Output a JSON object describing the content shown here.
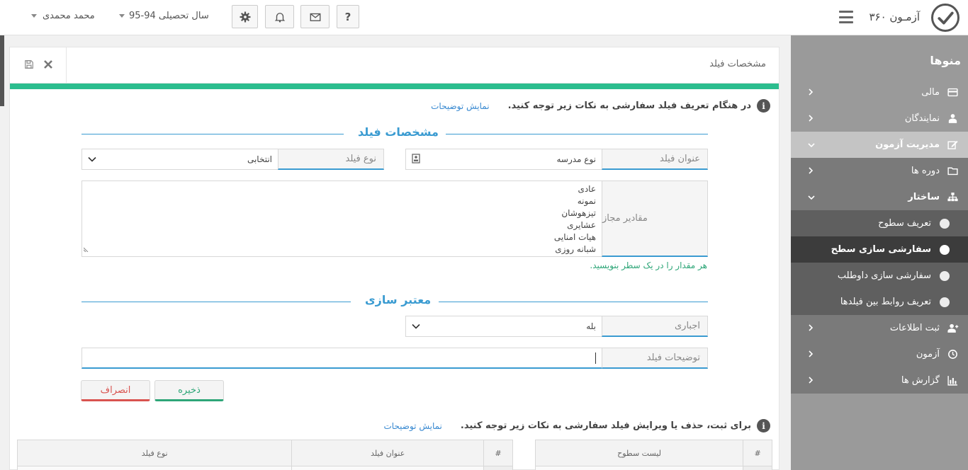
{
  "header": {
    "app_title": "آزمـون ۳۶۰",
    "year_label": "سال تحصیلی 94-95",
    "user_name": "محمد محمدی",
    "help_label": "?"
  },
  "sidebar": {
    "title": "منوها",
    "items": [
      {
        "label": "مالی"
      },
      {
        "label": "نمایندگان"
      },
      {
        "label": "مدیریت آزمون"
      },
      {
        "label": "دوره ها"
      },
      {
        "label": "ساختار"
      },
      {
        "label": "تعریف سطوح"
      },
      {
        "label": "سفارشی سازی سطح"
      },
      {
        "label": "سفارشی سازی داوطلب"
      },
      {
        "label": "تعریف روابط بین فیلدها"
      },
      {
        "label": "ثبت اطلاعات"
      },
      {
        "label": "آزمون"
      },
      {
        "label": "گزارش ها"
      }
    ]
  },
  "panel": {
    "title": "مشخصات فیلد",
    "notice1": {
      "text": "در هنگام تعریف فیلد سفارشی به نکات زیر توجه کنید.",
      "link": "نمایش توضیحات"
    },
    "section1_title": "مشخصات فیلد",
    "field_title": {
      "label": "عنوان فیلد",
      "value": "نوع مدرسه"
    },
    "field_type": {
      "label": "نوع فیلد",
      "value": "انتخابی"
    },
    "allowed_values": {
      "label": "مقادیر مجاز",
      "values": [
        "عادی",
        "نمونه",
        "تیزهوشان",
        "عشایری",
        "هیات امنایی",
        "شبانه روزی"
      ]
    },
    "hint": "هر مقدار را در یک سطر بنویسید.",
    "section2_title": "معتبر سازی",
    "required": {
      "label": "اجباری",
      "value": "بله"
    },
    "description": {
      "label": "توضیحات فیلد",
      "value": ""
    },
    "save_label": "ذخیره",
    "cancel_label": "انصراف",
    "notice2": {
      "text": "برای ثبت، حذف یا ویرایش فیلد سفارشی به نکات زیر توجه کنید.",
      "link": "نمایش توضیحات"
    },
    "table_fields": {
      "headers": [
        "#",
        "عنوان فیلد",
        "نوع فیلد"
      ]
    },
    "table_levels": {
      "headers": [
        "#",
        "لیست سطوح"
      ]
    }
  },
  "colors": {
    "accent": "#2bbd8e",
    "link": "#3a9bd1",
    "sidebar": "#9a9a9a"
  }
}
